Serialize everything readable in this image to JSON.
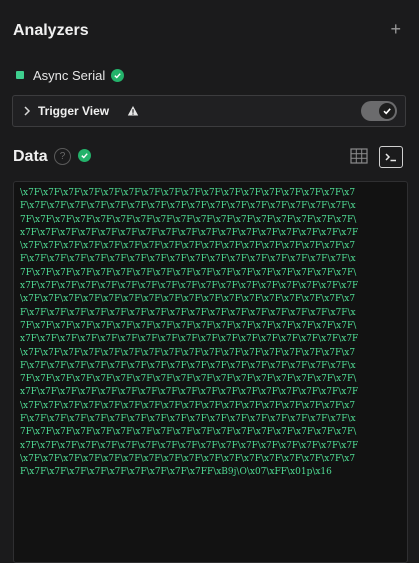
{
  "analyzers": {
    "title": "Analyzers",
    "add_label": "+",
    "items": [
      {
        "name": "Async Serial",
        "status_color": "#3ecf8e"
      }
    ]
  },
  "trigger": {
    "label": "Trigger View",
    "enabled": true
  },
  "data_panel": {
    "title": "Data",
    "help_label": "?",
    "terminal_lines": [
      "\\x7F\\x7F\\x7F\\x7F\\x7F\\x7F\\x7F\\x7F\\x7F\\x7F\\x7F\\x7F\\x7F\\x7F\\x7F\\x7F\\x7",
      "F\\x7F\\x7F\\x7F\\x7F\\x7F\\x7F\\x7F\\x7F\\x7F\\x7F\\x7F\\x7F\\x7F\\x7F\\x7F\\x7F\\x",
      "7F\\x7F\\x7F\\x7F\\x7F\\x7F\\x7F\\x7F\\x7F\\x7F\\x7F\\x7F\\x7F\\x7F\\x7F\\x7F\\x7F\\",
      "x7F\\x7F\\x7F\\x7F\\x7F\\x7F\\x7F\\x7F\\x7F\\x7F\\x7F\\x7F\\x7F\\x7F\\x7F\\x7F\\x7F",
      "\\x7F\\x7F\\x7F\\x7F\\x7F\\x7F\\x7F\\x7F\\x7F\\x7F\\x7F\\x7F\\x7F\\x7F\\x7F\\x7F\\x7",
      "F\\x7F\\x7F\\x7F\\x7F\\x7F\\x7F\\x7F\\x7F\\x7F\\x7F\\x7F\\x7F\\x7F\\x7F\\x7F\\x7F\\x",
      "7F\\x7F\\x7F\\x7F\\x7F\\x7F\\x7F\\x7F\\x7F\\x7F\\x7F\\x7F\\x7F\\x7F\\x7F\\x7F\\x7F\\",
      "x7F\\x7F\\x7F\\x7F\\x7F\\x7F\\x7F\\x7F\\x7F\\x7F\\x7F\\x7F\\x7F\\x7F\\x7F\\x7F\\x7F",
      "\\x7F\\x7F\\x7F\\x7F\\x7F\\x7F\\x7F\\x7F\\x7F\\x7F\\x7F\\x7F\\x7F\\x7F\\x7F\\x7F\\x7",
      "F\\x7F\\x7F\\x7F\\x7F\\x7F\\x7F\\x7F\\x7F\\x7F\\x7F\\x7F\\x7F\\x7F\\x7F\\x7F\\x7F\\x",
      "7F\\x7F\\x7F\\x7F\\x7F\\x7F\\x7F\\x7F\\x7F\\x7F\\x7F\\x7F\\x7F\\x7F\\x7F\\x7F\\x7F\\",
      "x7F\\x7F\\x7F\\x7F\\x7F\\x7F\\x7F\\x7F\\x7F\\x7F\\x7F\\x7F\\x7F\\x7F\\x7F\\x7F\\x7F",
      "\\x7F\\x7F\\x7F\\x7F\\x7F\\x7F\\x7F\\x7F\\x7F\\x7F\\x7F\\x7F\\x7F\\x7F\\x7F\\x7F\\x7",
      "F\\x7F\\x7F\\x7F\\x7F\\x7F\\x7F\\x7F\\x7F\\x7F\\x7F\\x7F\\x7F\\x7F\\x7F\\x7F\\x7F\\x",
      "7F\\x7F\\x7F\\x7F\\x7F\\x7F\\x7F\\x7F\\x7F\\x7F\\x7F\\x7F\\x7F\\x7F\\x7F\\x7F\\x7F\\",
      "x7F\\x7F\\x7F\\x7F\\x7F\\x7F\\x7F\\x7F\\x7F\\x7F\\x7F\\x7F\\x7F\\x7F\\x7F\\x7F\\x7F",
      "\\x7F\\x7F\\x7F\\x7F\\x7F\\x7F\\x7F\\x7F\\x7F\\x7F\\x7F\\x7F\\x7F\\x7F\\x7F\\x7F\\x7",
      "F\\x7F\\x7F\\x7F\\x7F\\x7F\\x7F\\x7F\\x7F\\x7F\\x7F\\x7F\\x7F\\x7F\\x7F\\x7F\\x7F\\x",
      "7F\\x7F\\x7F\\x7F\\x7F\\x7F\\x7F\\x7F\\x7F\\x7F\\x7F\\x7F\\x7F\\x7F\\x7F\\x7F\\x7F\\",
      "x7F\\x7F\\x7F\\x7F\\x7F\\x7F\\x7F\\x7F\\x7F\\x7F\\x7F\\x7F\\x7F\\x7F\\x7F\\x7F\\x7F",
      "\\x7F\\x7F\\x7F\\x7F\\x7F\\x7F\\x7F\\x7F\\x7F\\x7F\\x7F\\x7F\\x7F\\x7F\\x7F\\x7F\\x7",
      "F\\x7F\\x7F\\x7F\\x7F\\x7F\\x7F\\x7F\\x7F\\x7FF\\xB9j\\O\\x07\\xFF\\x01p\\x16"
    ],
    "text_color": "#4fdc94"
  },
  "icons": {
    "success": "check-circle-icon",
    "warning": "warning-triangle-icon",
    "table": "table-grid-icon",
    "terminal": "terminal-icon",
    "expand": "chevron-right-icon"
  }
}
